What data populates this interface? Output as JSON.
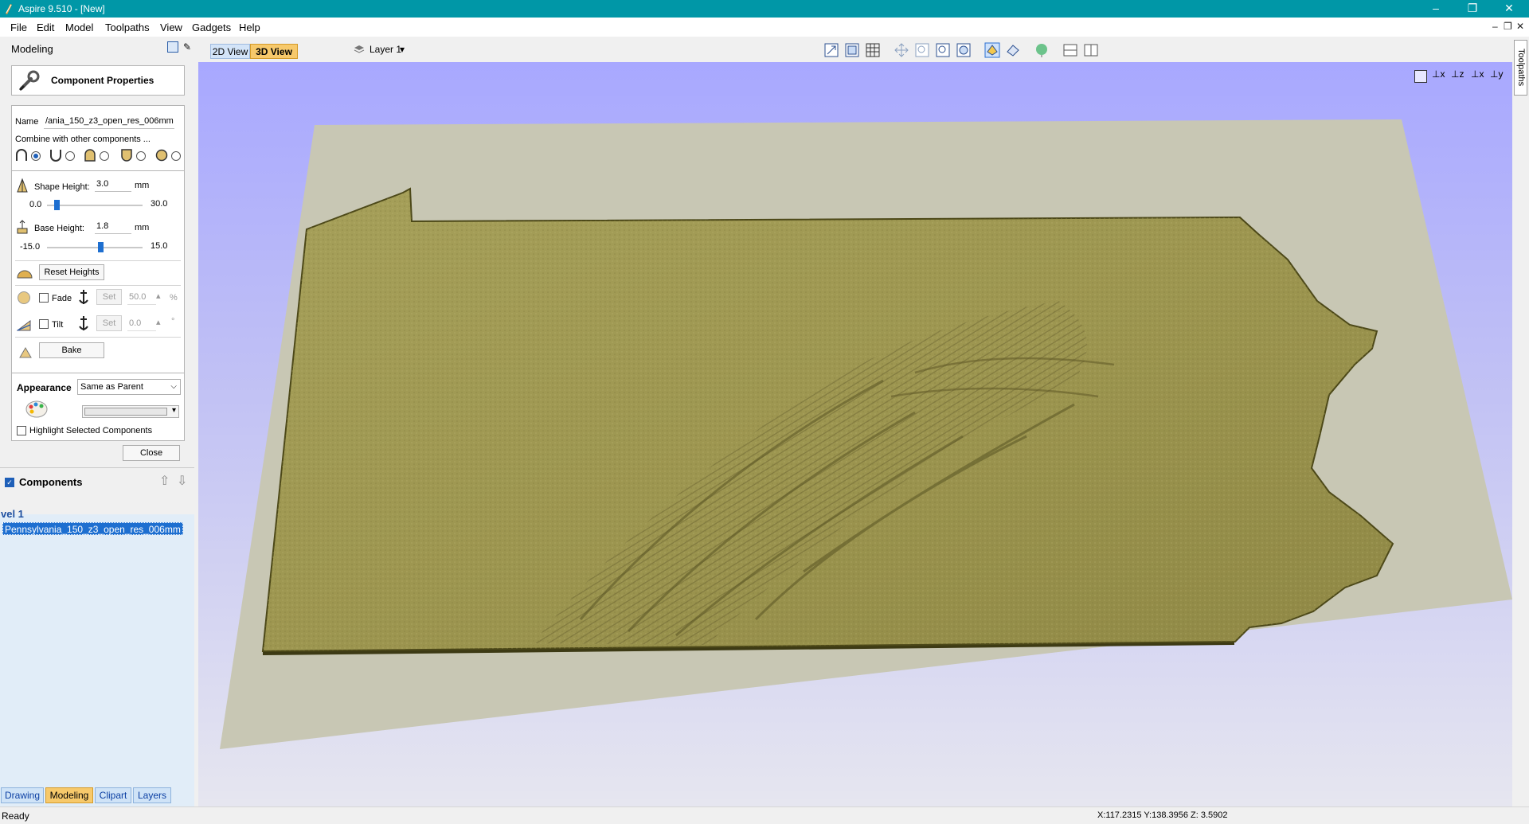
{
  "window": {
    "title": "Aspire 9.510 - [New]",
    "controls": {
      "minimize": "–",
      "maximize": "❐",
      "close": "✕"
    }
  },
  "menu": {
    "items": [
      "File",
      "Edit",
      "Model",
      "Toolpaths",
      "View",
      "Gadgets",
      "Help"
    ],
    "mdi_controls": {
      "minimize": "–",
      "restore": "❐",
      "close": "✕"
    }
  },
  "panel": {
    "title": "Modeling",
    "pin_glyph": "⊞",
    "pushpin_glyph": "✎"
  },
  "component_properties": {
    "header": "Component Properties",
    "name_label": "Name",
    "name_value": "/ania_150_z3_open_res_006mm",
    "combine_label": "Combine with other components ...",
    "combine_modes": [
      {
        "icon": "add-mode-icon",
        "selected": true
      },
      {
        "icon": "subtract-mode-icon",
        "selected": false
      },
      {
        "icon": "merge-high-mode-icon",
        "selected": false
      },
      {
        "icon": "merge-low-mode-icon",
        "selected": false
      },
      {
        "icon": "multiply-mode-icon",
        "selected": false
      }
    ],
    "shape_height": {
      "label": "Shape Height:",
      "value": "3.0",
      "unit": "mm",
      "min": "0.0",
      "max": "30.0",
      "position": 0.1
    },
    "base_height": {
      "label": "Base Height:",
      "value": "1.8",
      "unit": "mm",
      "min": "-15.0",
      "max": "15.0",
      "position": 0.56
    },
    "reset_heights": "Reset Heights",
    "fade": {
      "label": "Fade",
      "checked": false,
      "set_label": "Set",
      "value": "50.0",
      "unit": "%"
    },
    "tilt": {
      "label": "Tilt",
      "checked": false,
      "set_label": "Set",
      "value": "0.0",
      "unit": "°"
    },
    "bake": "Bake",
    "appearance_label": "Appearance",
    "appearance_value": "Same as Parent",
    "highlight_label": "Highlight Selected Components",
    "highlight_checked": false,
    "close": "Close"
  },
  "components": {
    "title": "Components",
    "checked": true,
    "level": "vel 1",
    "selected_item": "Pennsylvania_150_z3_open_res_006mm"
  },
  "bottom_tabs": [
    {
      "label": "Drawing",
      "active": false
    },
    {
      "label": "Modeling",
      "active": true
    },
    {
      "label": "Clipart",
      "active": false
    },
    {
      "label": "Layers",
      "active": false
    }
  ],
  "view_tabs": [
    {
      "label": "2D View",
      "active": false
    },
    {
      "label": "3D View",
      "active": true
    }
  ],
  "layer_selector": {
    "label": "Layer 1",
    "arrow": "▾"
  },
  "toolbar_icons": [
    "zoom-extents-icon",
    "zoom-box-icon",
    "grid-icon",
    "pan-icon",
    "zoom-in-icon",
    "zoom-out-icon",
    "zoom-fit-icon",
    "toggle-component-icon",
    "toggle-vector-icon",
    "shade-icon",
    "split-horizontal-icon",
    "split-vertical-icon"
  ],
  "view_orient_icons": [
    "view-fit-icon",
    "view-iso-icon",
    "view-z-icon",
    "view-x-icon",
    "view-y-icon"
  ],
  "view_orient_labels": [
    "",
    "x",
    "z",
    "x",
    "y"
  ],
  "right_tab": "Toolpaths",
  "status": {
    "left": "Ready",
    "coords": "X:117.2315 Y:138.3956 Z: 3.5902"
  }
}
